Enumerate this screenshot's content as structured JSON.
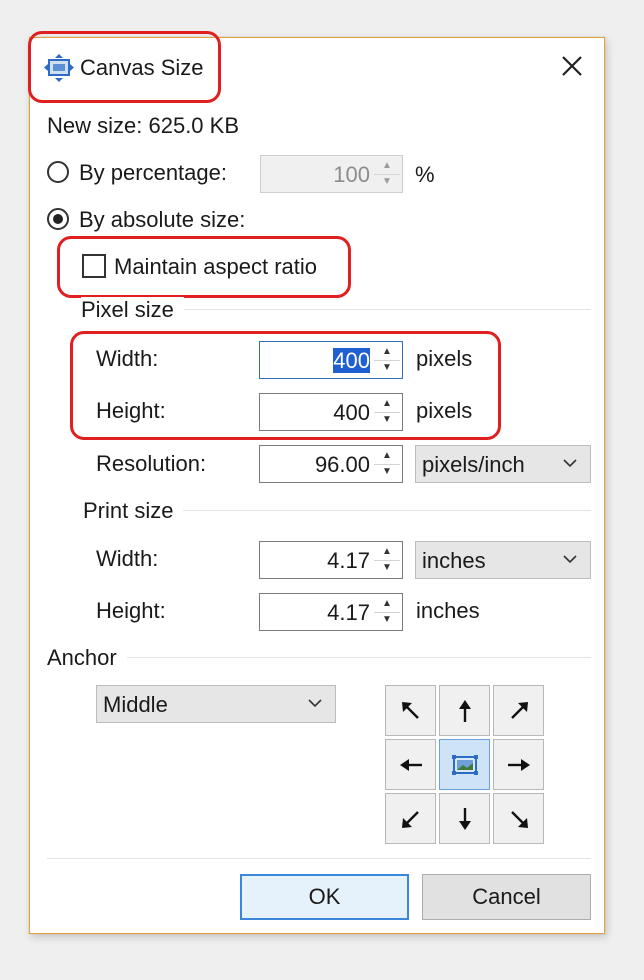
{
  "window": {
    "title": "Canvas Size"
  },
  "new_size": {
    "label": "New size:",
    "value": "625.0 KB"
  },
  "by_percentage": {
    "label": "By percentage:",
    "value": "100",
    "unit": "%",
    "selected": false
  },
  "by_absolute": {
    "label": "By absolute size:",
    "selected": true
  },
  "maintain_aspect": {
    "label": "Maintain aspect ratio",
    "checked": false
  },
  "pixel_size": {
    "header": "Pixel size",
    "width": {
      "label": "Width:",
      "value": "400",
      "unit": "pixels"
    },
    "height": {
      "label": "Height:",
      "value": "400",
      "unit": "pixels"
    },
    "resolution": {
      "label": "Resolution:",
      "value": "96.00",
      "unit": "pixels/inch"
    }
  },
  "print_size": {
    "header": "Print size",
    "width": {
      "label": "Width:",
      "value": "4.17",
      "unit": "inches"
    },
    "height": {
      "label": "Height:",
      "value": "4.17",
      "unit": "inches"
    }
  },
  "anchor": {
    "header": "Anchor",
    "selected": "Middle"
  },
  "buttons": {
    "ok": "OK",
    "cancel": "Cancel"
  },
  "colors": {
    "highlight": "#e02020",
    "accent": "#1f5fd1",
    "window_border": "#e5a23a"
  },
  "icons": [
    "canvas-size-icon",
    "close-icon",
    "chevron-down-icon",
    "arrow-up-left-icon",
    "arrow-up-icon",
    "arrow-up-right-icon",
    "arrow-left-icon",
    "image-icon",
    "arrow-right-icon",
    "arrow-down-left-icon",
    "arrow-down-icon",
    "arrow-down-right-icon"
  ]
}
